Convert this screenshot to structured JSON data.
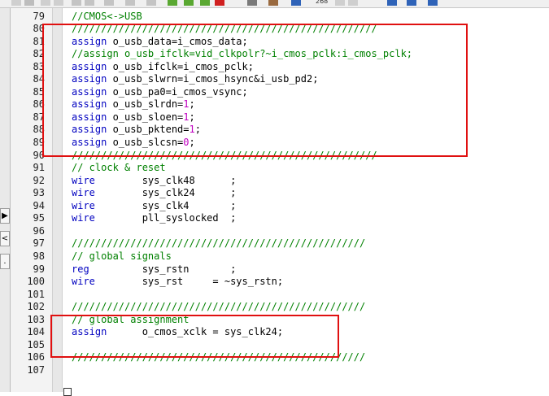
{
  "toolbar": {
    "counter_text": "268",
    "colors": {
      "icon_green": "#5aa832",
      "icon_blue": "#2f63b8",
      "icon_red": "#d02020",
      "icon_gray": "#7a7a7a"
    }
  },
  "left_panel": {
    "arrow_label": "▶",
    "less_label": "<",
    "dot_label": "."
  },
  "colors": {
    "keyword": "#0000c0",
    "comment": "#008000",
    "number": "#c000c0",
    "highlight_box": "#e01010",
    "gutter_bg": "#f3f3f3"
  },
  "editor": {
    "lines": [
      {
        "n": "79",
        "parts": [
          {
            "t": "cm",
            "v": "//CMOS<->USB"
          }
        ]
      },
      {
        "n": "80",
        "parts": [
          {
            "t": "cm",
            "v": "////////////////////////////////////////////////////"
          }
        ]
      },
      {
        "n": "81",
        "parts": [
          {
            "t": "kw",
            "v": "assign"
          },
          {
            "t": "tx",
            "v": " o_usb_data=i_cmos_data;"
          }
        ]
      },
      {
        "n": "82",
        "parts": [
          {
            "t": "cm",
            "v": "//assign o_usb_ifclk=vid_clkpolr?~i_cmos_pclk:i_cmos_pclk;"
          }
        ]
      },
      {
        "n": "83",
        "parts": [
          {
            "t": "kw",
            "v": "assign"
          },
          {
            "t": "tx",
            "v": " o_usb_ifclk=i_cmos_pclk;"
          }
        ]
      },
      {
        "n": "84",
        "parts": [
          {
            "t": "kw",
            "v": "assign"
          },
          {
            "t": "tx",
            "v": " o_usb_slwrn=i_cmos_hsync&i_usb_pd2;"
          }
        ]
      },
      {
        "n": "85",
        "parts": [
          {
            "t": "kw",
            "v": "assign"
          },
          {
            "t": "tx",
            "v": " o_usb_pa0=i_cmos_vsync;"
          }
        ]
      },
      {
        "n": "86",
        "parts": [
          {
            "t": "kw",
            "v": "assign"
          },
          {
            "t": "tx",
            "v": " o_usb_slrdn="
          },
          {
            "t": "num",
            "v": "1"
          },
          {
            "t": "tx",
            "v": ";"
          }
        ]
      },
      {
        "n": "87",
        "parts": [
          {
            "t": "kw",
            "v": "assign"
          },
          {
            "t": "tx",
            "v": " o_usb_sloen="
          },
          {
            "t": "num",
            "v": "1"
          },
          {
            "t": "tx",
            "v": ";"
          }
        ]
      },
      {
        "n": "88",
        "parts": [
          {
            "t": "kw",
            "v": "assign"
          },
          {
            "t": "tx",
            "v": " o_usb_pktend="
          },
          {
            "t": "num",
            "v": "1"
          },
          {
            "t": "tx",
            "v": ";"
          }
        ]
      },
      {
        "n": "89",
        "parts": [
          {
            "t": "kw",
            "v": "assign"
          },
          {
            "t": "tx",
            "v": " o_usb_slcsn="
          },
          {
            "t": "num",
            "v": "0"
          },
          {
            "t": "tx",
            "v": ";"
          }
        ]
      },
      {
        "n": "90",
        "parts": [
          {
            "t": "cm",
            "v": "////////////////////////////////////////////////////"
          }
        ]
      },
      {
        "n": "91",
        "parts": [
          {
            "t": "cm",
            "v": "// clock & reset"
          }
        ]
      },
      {
        "n": "92",
        "parts": [
          {
            "t": "kw",
            "v": "wire"
          },
          {
            "t": "tx",
            "v": "        sys_clk48      ;"
          }
        ]
      },
      {
        "n": "93",
        "parts": [
          {
            "t": "kw",
            "v": "wire"
          },
          {
            "t": "tx",
            "v": "        sys_clk24      ;"
          }
        ]
      },
      {
        "n": "94",
        "parts": [
          {
            "t": "kw",
            "v": "wire"
          },
          {
            "t": "tx",
            "v": "        sys_clk4       ;"
          }
        ]
      },
      {
        "n": "95",
        "parts": [
          {
            "t": "kw",
            "v": "wire"
          },
          {
            "t": "tx",
            "v": "        pll_syslocked  ;"
          }
        ]
      },
      {
        "n": "96",
        "parts": []
      },
      {
        "n": "97",
        "parts": [
          {
            "t": "cm",
            "v": "//////////////////////////////////////////////////"
          }
        ]
      },
      {
        "n": "98",
        "parts": [
          {
            "t": "cm",
            "v": "// global signals"
          }
        ]
      },
      {
        "n": "99",
        "parts": [
          {
            "t": "kw",
            "v": "reg"
          },
          {
            "t": "tx",
            "v": "         sys_rstn       ;"
          }
        ]
      },
      {
        "n": "100",
        "parts": [
          {
            "t": "kw",
            "v": "wire"
          },
          {
            "t": "tx",
            "v": "        sys_rst     = ~sys_rstn;"
          }
        ]
      },
      {
        "n": "101",
        "parts": []
      },
      {
        "n": "102",
        "parts": [
          {
            "t": "cm",
            "v": "//////////////////////////////////////////////////"
          }
        ]
      },
      {
        "n": "103",
        "parts": [
          {
            "t": "cm",
            "v": "// global assignment"
          }
        ]
      },
      {
        "n": "104",
        "parts": [
          {
            "t": "kw",
            "v": "assign"
          },
          {
            "t": "tx",
            "v": "      o_cmos_xclk = sys_clk24;"
          }
        ]
      },
      {
        "n": "105",
        "parts": []
      },
      {
        "n": "106",
        "parts": [
          {
            "t": "cm",
            "v": "//////////////////////////////////////////////////"
          }
        ]
      },
      {
        "n": "107",
        "parts": []
      }
    ]
  }
}
